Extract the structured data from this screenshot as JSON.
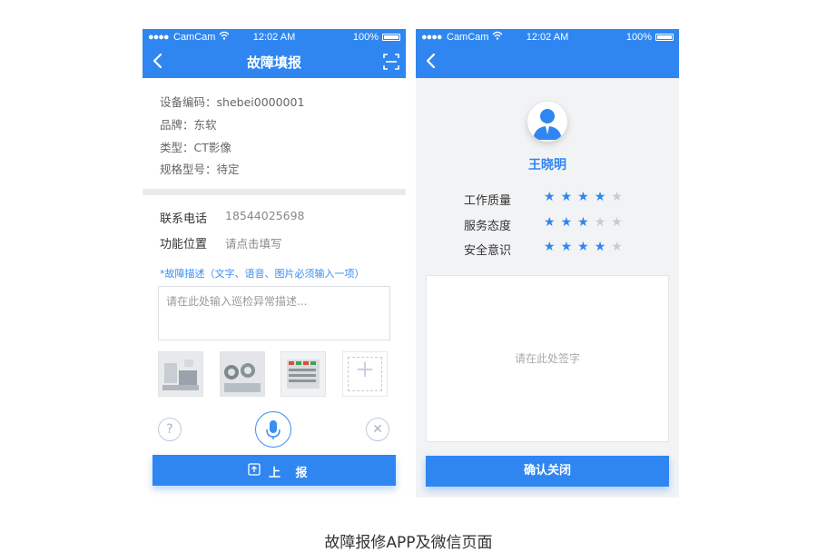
{
  "colors": {
    "accent": "#2f86f0",
    "star_off": "#c7ccd3",
    "hint": "#3a8ef0"
  },
  "status_bar": {
    "signal": "●●●●",
    "carrier": "CamCam",
    "time": "12:02 AM",
    "battery": "100%"
  },
  "left_screen": {
    "title": "故障填报",
    "device_info": [
      {
        "label": "设备编码：",
        "value": "shebei0000001"
      },
      {
        "label": "品牌：",
        "value": "东软"
      },
      {
        "label": "类型：",
        "value": "CT影像"
      },
      {
        "label": "规格型号：",
        "value": "待定"
      }
    ],
    "phone": {
      "label": "联系电话",
      "value": "18544025698"
    },
    "location": {
      "label": "功能位置",
      "placeholder": "请点击填写"
    },
    "description_hint": "*故障描述（文字、语音、图片必须输入一项）",
    "description_placeholder": "请在此处输入巡检异常描述...",
    "photos": [
      "photo-1",
      "photo-2",
      "photo-3"
    ],
    "help_glyph": "?",
    "close_glyph": "✕",
    "submit_label": "上 报"
  },
  "right_screen": {
    "name": "王晓明",
    "ratings": [
      {
        "label": "工作质量",
        "value": 4,
        "max": 5
      },
      {
        "label": "服务态度",
        "value": 3,
        "max": 5
      },
      {
        "label": "安全意识",
        "value": 4,
        "max": 5
      }
    ],
    "signature_placeholder": "请在此处签字",
    "confirm_label": "确认关闭"
  },
  "caption": "故障报修APP及微信页面"
}
